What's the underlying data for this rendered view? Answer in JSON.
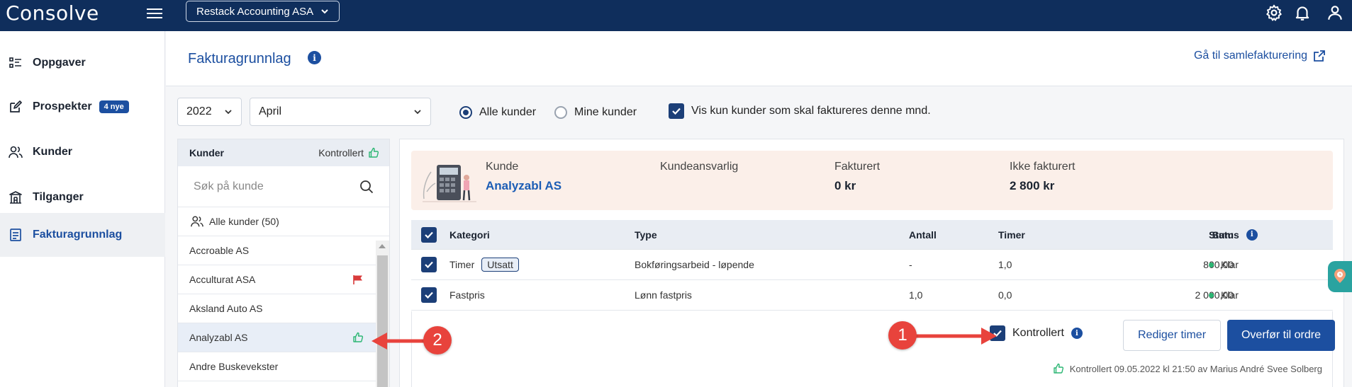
{
  "app": {
    "logo": "Consolve",
    "company": "Restack Accounting ASA"
  },
  "sidebar": {
    "items": [
      {
        "label": "Oppgaver"
      },
      {
        "label": "Prospekter",
        "badge": "4 nye"
      },
      {
        "label": "Kunder"
      },
      {
        "label": "Tilganger"
      },
      {
        "label": "Fakturagrunnlag"
      }
    ]
  },
  "header": {
    "title": "Fakturagrunnlag",
    "link": "Gå til samlefakturering"
  },
  "filters": {
    "year": "2022",
    "month": "April",
    "radio_all": "Alle kunder",
    "radio_mine": "Mine kunder",
    "checkbox_label": "Vis kun kunder som skal faktureres denne mnd."
  },
  "customers": {
    "head_title": "Kunder",
    "head_controlled": "Kontrollert",
    "search_placeholder": "Søk på kunde",
    "all_label": "Alle kunder (50)",
    "rows": [
      {
        "name": "Accroable AS",
        "mark": ""
      },
      {
        "name": "Acculturat ASA",
        "mark": "flag"
      },
      {
        "name": "Aksland Auto AS",
        "mark": ""
      },
      {
        "name": "Analyzabl AS",
        "mark": "thumb"
      },
      {
        "name": "Andre Buskevekster",
        "mark": ""
      }
    ]
  },
  "summary": {
    "kunde_label": "Kunde",
    "kunde_value": "Analyzabl AS",
    "ansvarlig_label": "Kundeansvarlig",
    "fakturert_label": "Fakturert",
    "fakturert_value": "0 kr",
    "ikke_label": "Ikke fakturert",
    "ikke_value": "2 800 kr"
  },
  "table": {
    "headers": {
      "kategori": "Kategori",
      "type": "Type",
      "antall": "Antall",
      "timer": "Timer",
      "sum": "Sum",
      "status": "Status"
    },
    "rows": [
      {
        "kategori": "Timer",
        "tag": "Utsatt",
        "type": "Bokføringsarbeid - løpende",
        "antall": "-",
        "timer": "1,0",
        "sum": "800,00",
        "status": "Klar"
      },
      {
        "kategori": "Fastpris",
        "tag": "",
        "type": "Lønn fastpris",
        "antall": "1,0",
        "timer": "0,0",
        "sum": "2 000,00",
        "status": "Klar"
      }
    ]
  },
  "footer": {
    "kontrollert_label": "Kontrollert",
    "edit_button": "Rediger timer",
    "transfer_button": "Overfør til ordre",
    "note": "Kontrollert 09.05.2022 kl 21:50 av Marius André Svee Solberg"
  },
  "annotations": {
    "one": "1",
    "two": "2"
  },
  "colors": {
    "primary": "#1c4fa0",
    "topbar": "#0f2e5c",
    "annotation": "#e8433c",
    "status_green": "#2bb673"
  }
}
